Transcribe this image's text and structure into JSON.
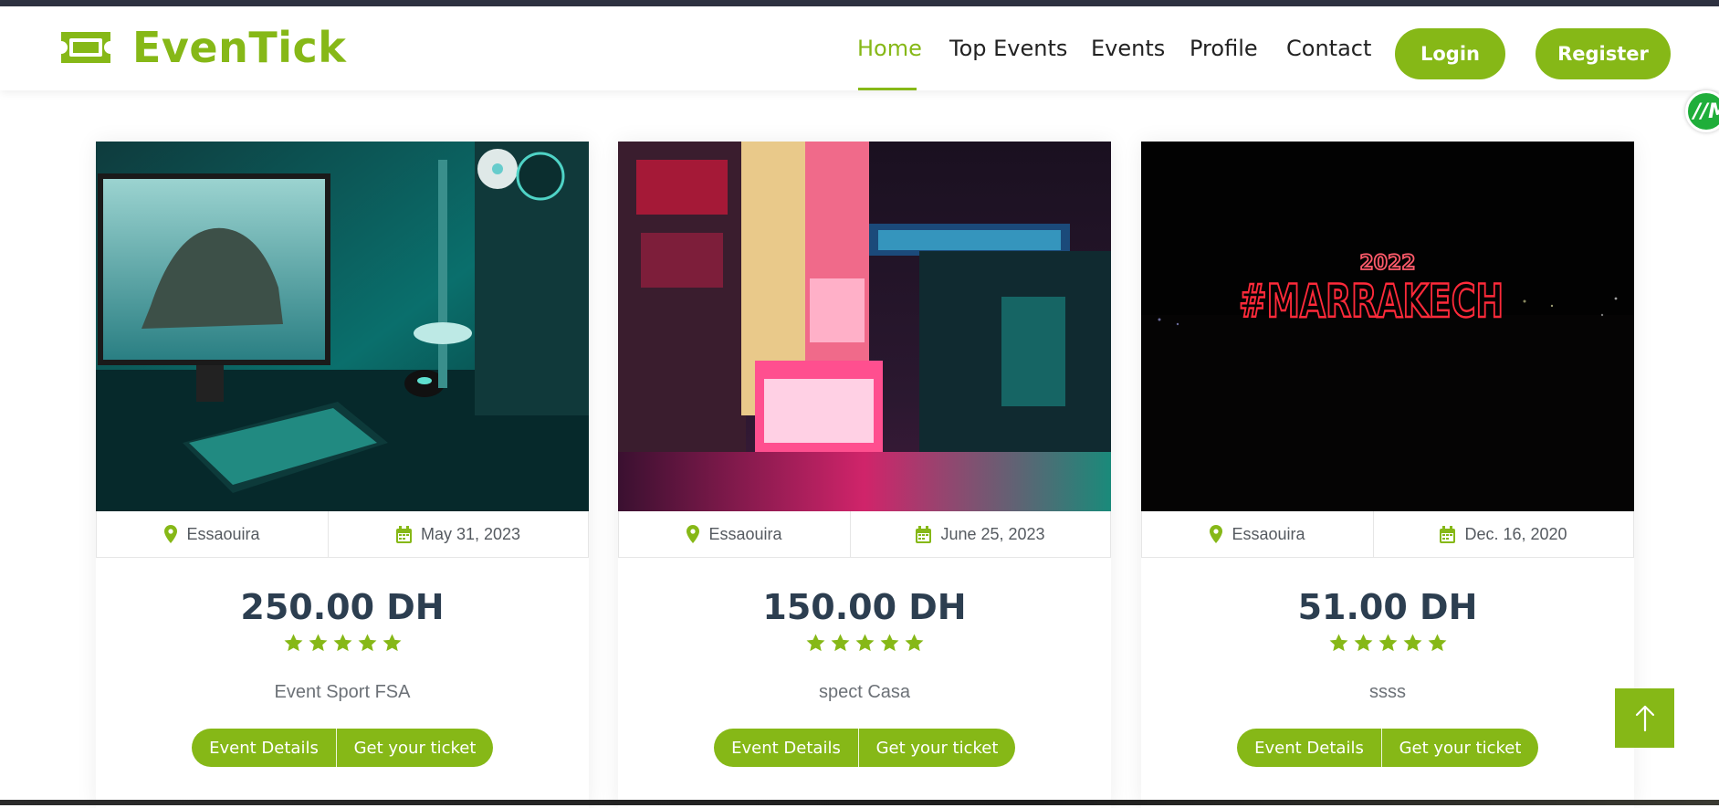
{
  "brand": {
    "name": "EvenTick",
    "accent": "#86b817"
  },
  "nav": {
    "items": [
      {
        "label": "Home",
        "active": true
      },
      {
        "label": "Top Events",
        "active": false
      },
      {
        "label": "Events",
        "active": false
      },
      {
        "label": "Profile",
        "active": false
      },
      {
        "label": "Contact",
        "active": false
      }
    ],
    "login_label": "Login",
    "register_label": "Register"
  },
  "floating_widget": {
    "label": "//M"
  },
  "events": [
    {
      "location": "Essaouira",
      "date": "May 31, 2023",
      "price": "250.00 DH",
      "rating": 5,
      "title": "Event Sport FSA",
      "details_label": "Event Details",
      "ticket_label": "Get your ticket"
    },
    {
      "location": "Essaouira",
      "date": "June 25, 2023",
      "price": "150.00 DH",
      "rating": 5,
      "title": "spect Casa",
      "details_label": "Event Details",
      "ticket_label": "Get your ticket"
    },
    {
      "location": "Essaouira",
      "date": "Dec. 16, 2020",
      "price": "51.00 DH",
      "rating": 5,
      "title": "ssss",
      "details_label": "Event Details",
      "ticket_label": "Get your ticket"
    }
  ],
  "event_images": {
    "image3_sign_year": "2022",
    "image3_sign_text": "#MARRAKECH"
  },
  "icons": {
    "location": "map-pin-icon",
    "date": "calendar-icon",
    "rating": "star-icon",
    "scroll_top": "arrow-up-icon"
  }
}
